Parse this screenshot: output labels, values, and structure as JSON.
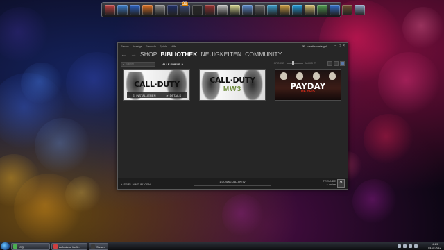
{
  "desktop": {
    "dock_icons": [
      "monitor-icon",
      "calendar-icon",
      "ie-icon",
      "firefox-icon",
      "gear-icon",
      "media-player-icon",
      "display-icon",
      "steam-icon",
      "film-icon",
      "disk-icon",
      "notes-icon",
      "contact-icon",
      "camera-icon",
      "network-icon",
      "package-icon",
      "skype-icon",
      "folder-icon",
      "chat-icon",
      "windows-icon",
      "briefcase-icon",
      "recycle-bin-icon"
    ],
    "dock_badge": "39"
  },
  "steam": {
    "menubar": [
      "Steam",
      "Anzeige",
      "Freunde",
      "Spiele",
      "Hilfe"
    ],
    "account_name": "deathnote0ngel",
    "nav": {
      "back_arrow": "←",
      "forward_arrow": "→",
      "links": [
        "SHOP",
        "BIBLIOTHEK",
        "NEUIGKEITEN",
        "COMMUNITY"
      ],
      "active": "BIBLIOTHEK"
    },
    "toolbar": {
      "search_placeholder": "Suchen",
      "filter_label": "ALLE SPIELE",
      "filter_caret": "▾",
      "zoom_label": "GROSSE",
      "zoom_value": 0.4,
      "view_label": "ANSICHT"
    },
    "games": [
      {
        "title": "CALL·DUTY",
        "subtitle": "",
        "overlay": {
          "install": "INSTALLIEREN",
          "details": "DETAILS"
        }
      },
      {
        "title": "CALL·DUTY",
        "subtitle": "MW3"
      },
      {
        "title": "PAYDAY",
        "subtitle": "THE HEIST"
      }
    ],
    "statusbar": {
      "add_game": "SPIEL HINZUFÜGEN",
      "add_plus": "+",
      "download": "1 DOWNLOAD AKTIV",
      "friends_label": "FREUNDE",
      "friends_sub": "+ online",
      "help": "?"
    }
  },
  "taskbar": {
    "tasks": [
      {
        "label": "ICQ",
        "color": "#4caf50"
      },
      {
        "label": "Aufnahme läuft...",
        "color": "#d04040"
      },
      {
        "label": "Steam",
        "color": "#3a3a3a"
      }
    ],
    "clock_time": "16:29",
    "clock_date": "04.02.2012"
  }
}
